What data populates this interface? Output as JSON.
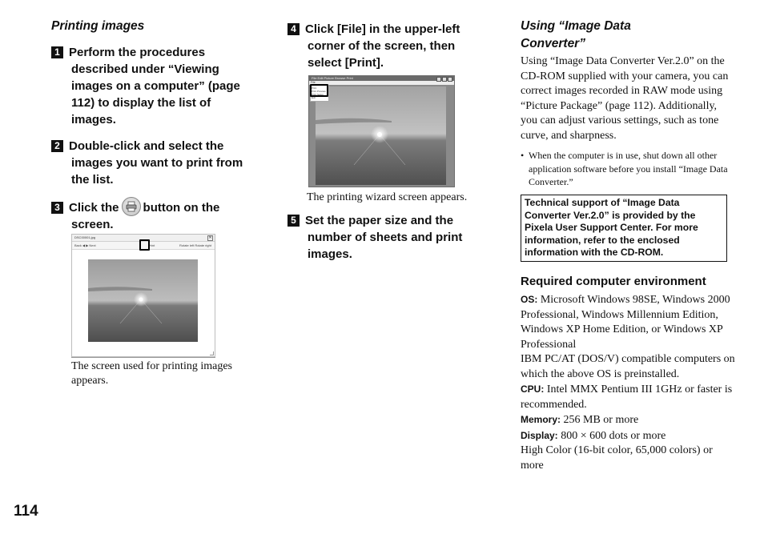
{
  "page_number": "114",
  "left_column": {
    "section_title": "Printing images",
    "steps": [
      {
        "num": "1",
        "lines": [
          "Perform the procedures",
          "described under “Viewing",
          "images on a computer” (page",
          "112) to display the list of",
          "images."
        ]
      },
      {
        "num": "2",
        "lines": [
          "Double-click and select the",
          "images you want to print from",
          "the list."
        ]
      },
      {
        "num": "3",
        "line1_before": "Click the",
        "line1_after": "button on the",
        "line2": "screen.",
        "icon": "printer-icon"
      }
    ],
    "screenshot": {
      "window_title": "DSC00001.jpg",
      "toolbar_left": "Back ◀  ▶ Next",
      "toolbar_mid": "Print",
      "toolbar_right": "Rotate left  Rotate right",
      "close_glyph": "✕"
    },
    "caption": "The screen used for printing images appears."
  },
  "middle_column": {
    "steps": [
      {
        "num": "4",
        "lines": [
          "Click [File] in the upper-left",
          "corner of the screen, then",
          "select [Print]."
        ]
      },
      {
        "num": "5",
        "lines": [
          "Set the paper size and the",
          "number of sheets and print",
          "images."
        ]
      }
    ],
    "screenshot": {
      "menubar": "File  Edit  Picture  Browse  Print",
      "menu_file": "File",
      "menu_items": [
        "Print",
        "Print Preview",
        "Print Setup",
        "Exit"
      ]
    },
    "caption": "The printing wizard screen appears."
  },
  "right_column": {
    "section_title_line1": "Using “Image Data",
    "section_title_line2": "Converter”",
    "intro": "Using “Image Data Converter Ver.2.0” on the CD-ROM supplied with your camera, you can correct images recorded in RAW mode using “Picture Package” (page 112). Additionally, you can adjust various settings, such as tone curve, and sharpness.",
    "note_bullet": "•",
    "note": "When the computer is in use, shut down all other application software before you install “Image Data Converter.”",
    "support_box": "Technical support of “Image Data Converter Ver.2.0”  is provided by the Pixela User Support Center. For more information, refer to the enclosed information with the CD-ROM.",
    "requirements_title": "Required computer environment",
    "requirements": {
      "os_label": "OS:",
      "os_value": "Microsoft Windows 98SE, Windows 2000 Professional, Windows Millennium Edition, Windows XP Home Edition, or Windows XP Professional",
      "os_extra": "IBM PC/AT (DOS/V) compatible computers on which the above OS is preinstalled.",
      "cpu_label": "CPU:",
      "cpu_value": "Intel MMX Pentium III 1GHz or faster is recommended.",
      "memory_label": "Memory:",
      "memory_value": "256 MB or more",
      "display_label": "Display:",
      "display_value": "800 × 600 dots or more",
      "display_extra": "High Color (16-bit color, 65,000 colors) or more"
    }
  }
}
